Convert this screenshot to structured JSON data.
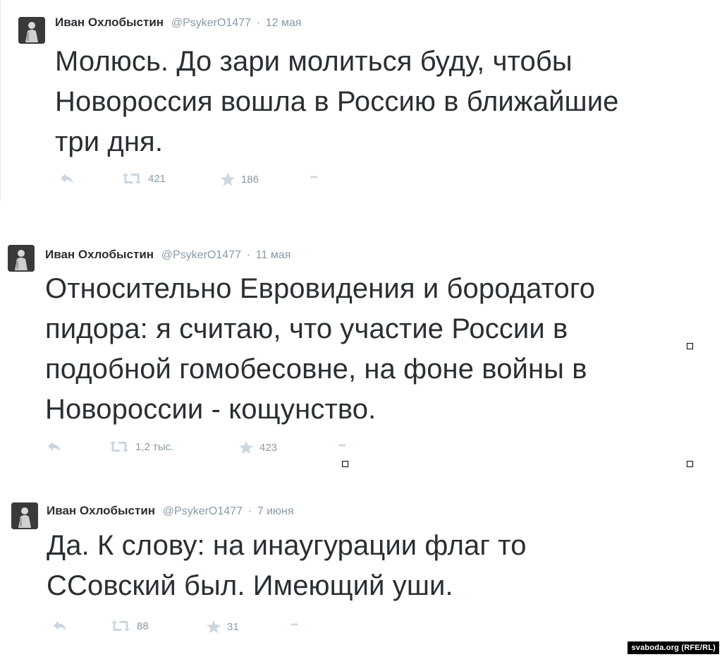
{
  "tweets": [
    {
      "name": "Иван Охлобыстин",
      "handle": "@PsykerO1477",
      "date": "12 мая",
      "lines": [
        "Молюсь. До зари молиться буду, чтобы",
        "Новороссия вошла в Россию в ближайшие",
        "три дня."
      ],
      "retweets": "421",
      "favorites": "186"
    },
    {
      "name": "Иван Охлобыстин",
      "handle": "@PsykerO1477",
      "date": "11 мая",
      "lines": [
        "Относительно Евровидения и бородатого",
        "пидора: я считаю, что участие России в",
        "подобной гомобесовне, на фоне войны в",
        "Новороссии - кощунство."
      ],
      "retweets": "1,2 тыс.",
      "favorites": "423"
    },
    {
      "name": "Иван Охлобыстин",
      "handle": "@PsykerO1477",
      "date": "7 июня",
      "lines": [
        "Да. К слову: на инаугурации флаг то",
        "ССовский был. Имеющий уши."
      ],
      "retweets": "88",
      "favorites": "31"
    }
  ],
  "separator": "·",
  "more_glyph": "•••",
  "watermark": "svaboda.org (RFE/RL)",
  "icons": {
    "reply": "reply-icon",
    "retweet": "retweet-icon",
    "favorite": "star-icon",
    "more": "more-icon"
  },
  "colors": {
    "text": "#292f33",
    "muted": "#8899a6",
    "icon": "#ccd6dd"
  }
}
